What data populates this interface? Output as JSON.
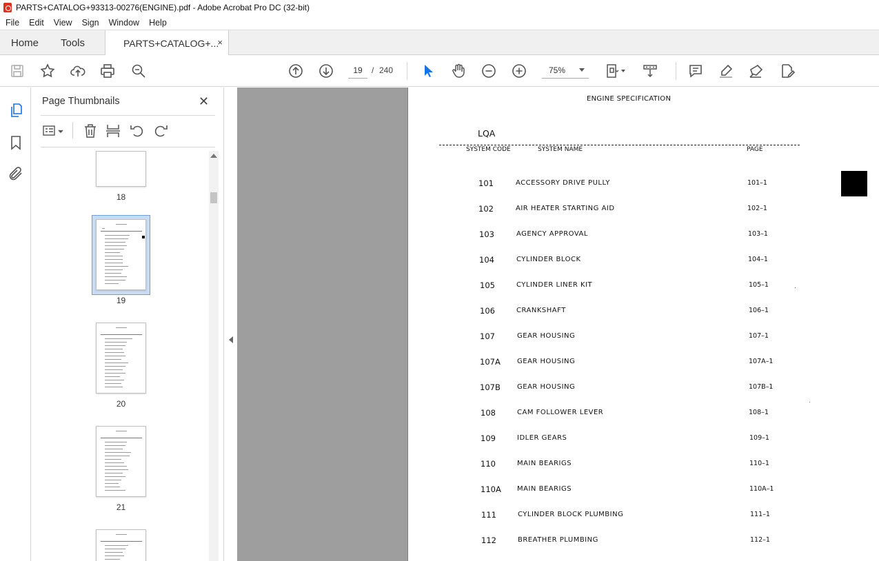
{
  "window": {
    "title": "PARTS+CATALOG+93313-00276(ENGINE).pdf - Adobe Acrobat Pro DC (32-bit)"
  },
  "menu": [
    "File",
    "Edit",
    "View",
    "Sign",
    "Window",
    "Help"
  ],
  "tabs": {
    "home": "Home",
    "tools": "Tools",
    "doc": "PARTS+CATALOG+...",
    "close": "×"
  },
  "toolbar": {
    "page_current": "19",
    "page_sep": "/",
    "page_total": "240",
    "zoom": "75%"
  },
  "thumbnails": {
    "title": "Page Thumbnails",
    "close": "✕",
    "pages": [
      "18",
      "19",
      "20",
      "21"
    ],
    "selected": "19"
  },
  "document": {
    "heading": "ENGINE  SPECIFICATION",
    "model": "LQA",
    "columns": {
      "code": "SYSTEM CODE",
      "name": "SYSTEM  NAME",
      "page": "PAGE"
    },
    "rows": [
      {
        "code": "101",
        "name": "ACCESSORY  DRIVE  PULLY",
        "page": "101–1"
      },
      {
        "code": "102",
        "name": "AIR  HEATER  STARTING  AID",
        "page": "102–1"
      },
      {
        "code": "103",
        "name": "AGENCY  APPROVAL",
        "page": "103–1"
      },
      {
        "code": "104",
        "name": "CYLINDER  BLOCK",
        "page": "104–1"
      },
      {
        "code": "105",
        "name": "CYLINDER  LINER  KIT",
        "page": "105–1"
      },
      {
        "code": "106",
        "name": "CRANKSHAFT",
        "page": "106–1"
      },
      {
        "code": "107",
        "name": "GEAR  HOUSING",
        "page": "107–1"
      },
      {
        "code": "107A",
        "name": "GEAR  HOUSING",
        "page": "107A–1"
      },
      {
        "code": "107B",
        "name": "GEAR  HOUSING",
        "page": "107B–1"
      },
      {
        "code": "108",
        "name": "CAM  FOLLOWER  LEVER",
        "page": "108–1"
      },
      {
        "code": "109",
        "name": "IDLER  GEARS",
        "page": "109–1"
      },
      {
        "code": "110",
        "name": "MAIN  BEARIGS",
        "page": "110–1"
      },
      {
        "code": "110A",
        "name": "MAIN  BEARIGS",
        "page": "110A–1"
      },
      {
        "code": "111",
        "name": "CYLINDER  BLOCK  PLUMBING",
        "page": "111–1"
      },
      {
        "code": "112",
        "name": "BREATHER  PLUMBING",
        "page": "112–1"
      }
    ]
  },
  "colors": {
    "selection": "#c9dcf3",
    "doc_background": "#9e9e9e",
    "select_tool": "#1473e6"
  },
  "icons": [
    "save-icon",
    "star-icon",
    "upload-icon",
    "print-icon",
    "zoom-search-icon",
    "page-up-icon",
    "page-down-icon",
    "select-cursor-icon",
    "hand-icon",
    "zoom-out-icon",
    "zoom-in-icon",
    "page-fit-icon",
    "scroll-mode-icon",
    "comment-icon",
    "highlight-icon",
    "sign-icon",
    "edit-pdf-icon"
  ]
}
